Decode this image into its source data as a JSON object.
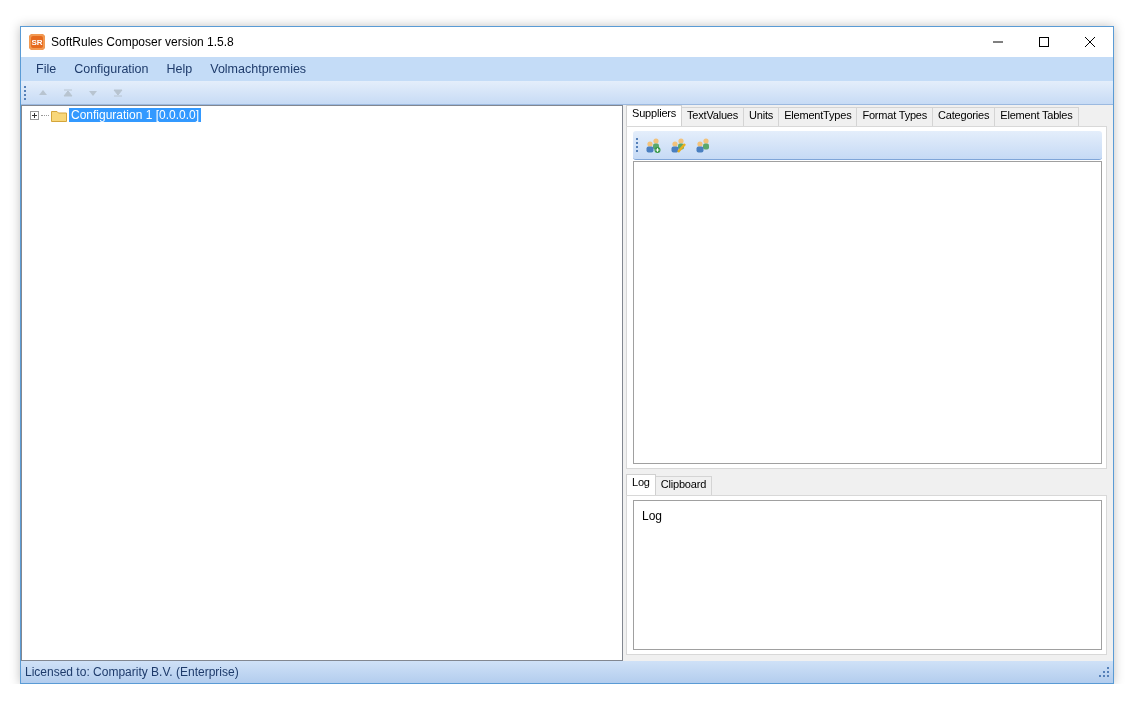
{
  "window": {
    "title": "SoftRules Composer version 1.5.8",
    "logo": "SR"
  },
  "menu": [
    "File",
    "Configuration",
    "Help",
    "Volmachtpremies"
  ],
  "tree": [
    {
      "label": "Configuration 1 [0.0.0.0]",
      "expanded": false,
      "selected": true
    }
  ],
  "tabs": [
    {
      "label": "Suppliers",
      "selected": true
    },
    {
      "label": "TextValues",
      "selected": false
    },
    {
      "label": "Units",
      "selected": false
    },
    {
      "label": "ElementTypes",
      "selected": false
    },
    {
      "label": "Format Types",
      "selected": false
    },
    {
      "label": "Categories",
      "selected": false
    },
    {
      "label": "Element Tables",
      "selected": false
    }
  ],
  "log_tabs": [
    {
      "label": "Log",
      "selected": true
    },
    {
      "label": "Clipboard",
      "selected": false
    }
  ],
  "log": {
    "text": "Log"
  },
  "status_bar": "Licensed to: Comparity B.V. (Enterprise)"
}
